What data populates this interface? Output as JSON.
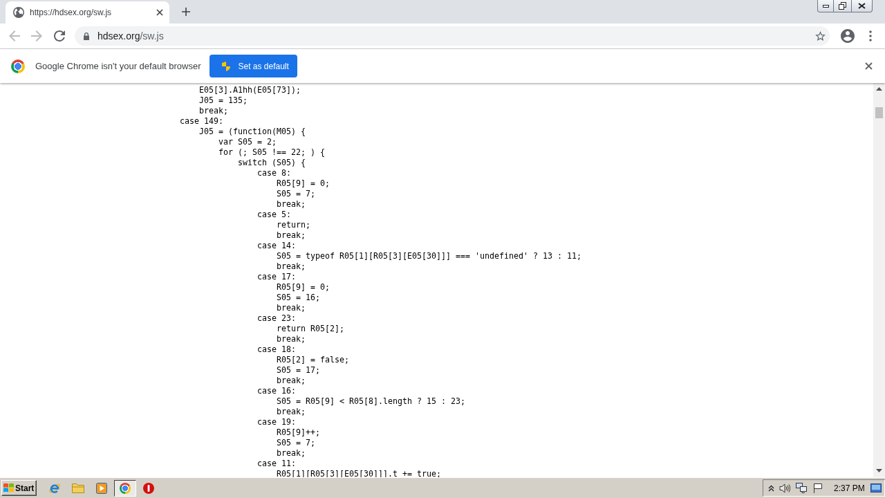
{
  "browser": {
    "tabs": [
      {
        "title": "https://hdsex.org/sw.js",
        "selected": true
      }
    ],
    "address_bar": {
      "host": "hdsex.org",
      "path": "/sw.js"
    }
  },
  "infobar": {
    "message": "Google Chrome isn't your default browser",
    "button": "Set as default"
  },
  "page_content": {
    "lines": [
      "    E05[3].A1hh(E05[73]);",
      "    J05 = 135;",
      "    break;",
      "case 149:",
      "    J05 = (function(M05) {",
      "        var S05 = 2;",
      "        for (; S05 !== 22; ) {",
      "            switch (S05) {",
      "                case 8:",
      "                    R05[9] = 0;",
      "                    S05 = 7;",
      "                    break;",
      "                case 5:",
      "                    return;",
      "                    break;",
      "                case 14:",
      "                    S05 = typeof R05[1][R05[3][E05[30]]] === 'undefined' ? 13 : 11;",
      "                    break;",
      "                case 17:",
      "                    R05[9] = 0;",
      "                    S05 = 16;",
      "                    break;",
      "                case 23:",
      "                    return R05[2];",
      "                    break;",
      "                case 18:",
      "                    R05[2] = false;",
      "                    S05 = 17;",
      "                    break;",
      "                case 16:",
      "                    S05 = R05[9] < R05[8].length ? 15 : 23;",
      "                    break;",
      "                case 19:",
      "                    R05[9]++;",
      "                    S05 = 7;",
      "                    break;",
      "                case 11:",
      "                    R05[1][R05[3][E05[30]]].t += true;"
    ]
  },
  "taskbar": {
    "start": "Start",
    "apps": [
      {
        "kind": "ie",
        "selected": false
      },
      {
        "kind": "folder",
        "selected": false
      },
      {
        "kind": "media",
        "selected": false
      },
      {
        "kind": "chrome",
        "selected": true
      },
      {
        "kind": "alert",
        "selected": false
      }
    ],
    "clock": "2:37 PM"
  }
}
